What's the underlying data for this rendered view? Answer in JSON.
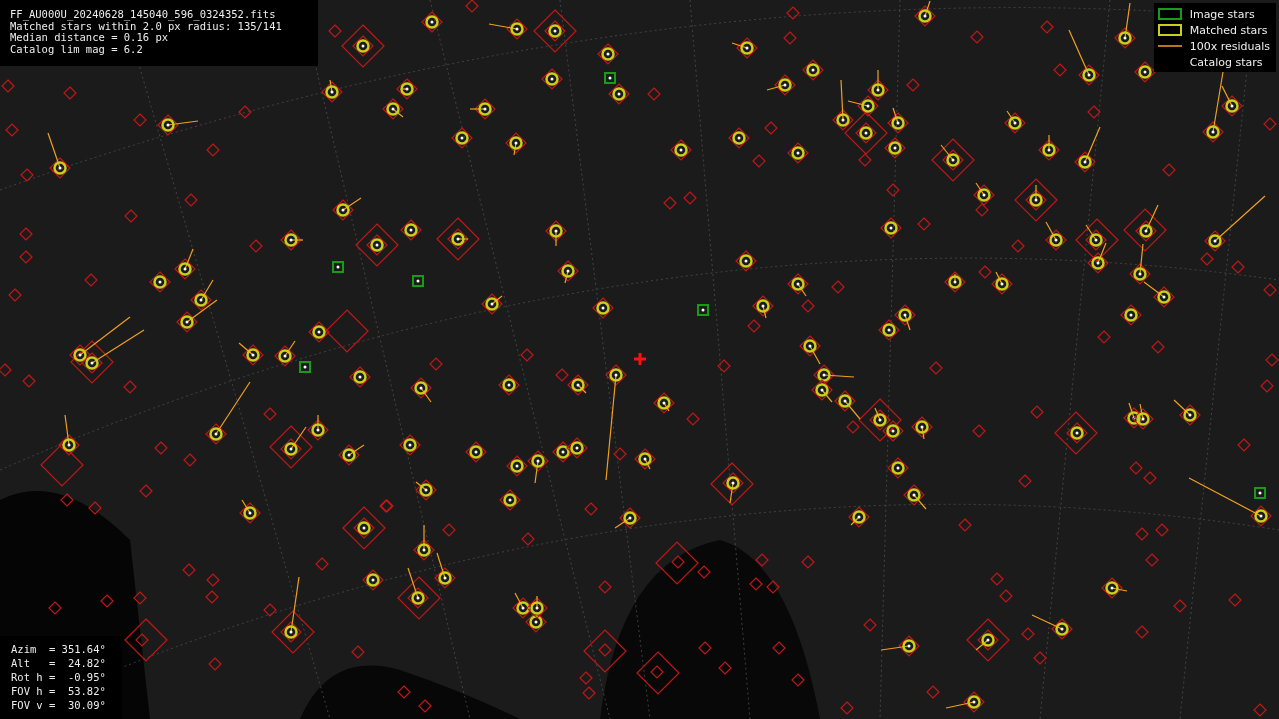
{
  "file_info": [
    "FF_AU000U_20240628_145040_596_0324352.fits",
    "Matched stars within 2.0 px radius: 135/141",
    "Median distance = 0.16 px",
    "Catalog lim mag = 6.2"
  ],
  "legend": [
    {
      "kind": "image",
      "label": "Image stars"
    },
    {
      "kind": "matched",
      "label": "Matched stars"
    },
    {
      "kind": "residual",
      "label": "100x residuals"
    },
    {
      "kind": "catalog",
      "label": "Catalog stars"
    }
  ],
  "pointing": [
    "Azim  = 351.64°",
    "Alt   =  24.82°",
    "Rot h =  -0.95°",
    "FOV h =  53.82°",
    "FOV v =  30.09°"
  ]
}
